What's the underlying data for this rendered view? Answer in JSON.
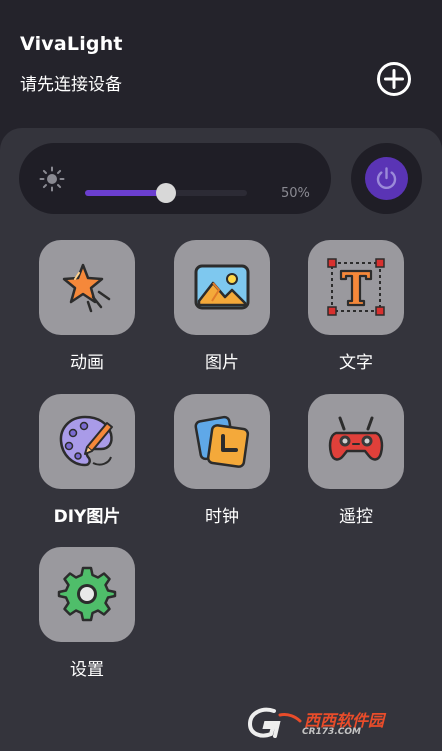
{
  "header": {
    "title": "VivaLight",
    "subtitle": "请先连接设备"
  },
  "brightness": {
    "level": 0.5,
    "percent_label": "50%"
  },
  "tiles": [
    {
      "label": "动画",
      "icon": "star-animation-icon"
    },
    {
      "label": "图片",
      "icon": "picture-icon"
    },
    {
      "label": "文字",
      "icon": "text-icon"
    },
    {
      "label": "DIY图片",
      "icon": "palette-icon"
    },
    {
      "label": "时钟",
      "icon": "clock-icon"
    },
    {
      "label": "遥控",
      "icon": "gamepad-icon"
    },
    {
      "label": "设置",
      "icon": "gear-icon"
    }
  ],
  "watermark": {
    "brand": "西西软件园",
    "url": "CR173.COM"
  },
  "colors": {
    "background": "#24232b",
    "panel": "#34343c",
    "accent": "#6b3fd0",
    "tile": "#9a999e"
  }
}
